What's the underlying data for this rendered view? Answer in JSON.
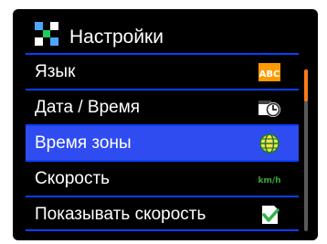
{
  "header": {
    "title": "Настройки",
    "icon": "settings-grid-icon"
  },
  "menu": {
    "items": [
      {
        "label": "Язык",
        "icon": "language-abc-icon",
        "selected": false
      },
      {
        "label": "Дата / Время",
        "icon": "date-time-clock-icon",
        "selected": false
      },
      {
        "label": "Время зоны",
        "icon": "globe-icon",
        "selected": true
      },
      {
        "label": "Скорость",
        "icon": "kmh-speed-icon",
        "icon_text": "km/h",
        "selected": false
      },
      {
        "label": "Показывать скорость",
        "icon": "checkmark-icon",
        "selected": false
      }
    ]
  },
  "scrollbar": {
    "position_fraction": 0.0,
    "visible_fraction": 0.2
  },
  "colors": {
    "background": "#000000",
    "divider": "#0a3fff",
    "selected_row": "#2f4cf0",
    "scroll_thumb": "#ff7a1a",
    "abc_icon": "#ff9a00",
    "kmh_icon": "#3aa63a"
  }
}
